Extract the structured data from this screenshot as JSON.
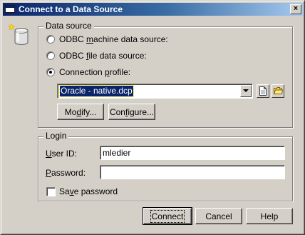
{
  "window": {
    "title": "Connect to a Data Source",
    "close_glyph": "×"
  },
  "data_source": {
    "legend": "Data source",
    "options": [
      {
        "label_pre": "ODBC ",
        "label_accel": "m",
        "label_post": "achine data source:",
        "checked": false
      },
      {
        "label_pre": "ODBC ",
        "label_accel": "f",
        "label_post": "ile data source:",
        "checked": false
      },
      {
        "label_pre": "Connection ",
        "label_accel": "p",
        "label_post": "rofile:",
        "checked": true
      }
    ],
    "profile_value": "Oracle - native.dcp",
    "modify_pre": "Mo",
    "modify_accel": "d",
    "modify_post": "ify...",
    "configure_pre": "Con",
    "configure_accel": "f",
    "configure_post": "igure..."
  },
  "login": {
    "legend": "Login",
    "user_id_accel": "U",
    "user_id_post": "ser ID:",
    "user_id_value": "mledier",
    "password_accel": "P",
    "password_post": "assword:",
    "password_value": "",
    "save_password_pre": "Sa",
    "save_password_accel": "v",
    "save_password_post": "e password",
    "save_password_checked": false
  },
  "footer": {
    "connect_label": "Connect",
    "cancel_label": "Cancel",
    "help_label": "Help"
  },
  "colors": {
    "face": "#d4d0c8",
    "title_start": "#0a246a",
    "title_end": "#a6caf0",
    "selection": "#0a246a"
  }
}
